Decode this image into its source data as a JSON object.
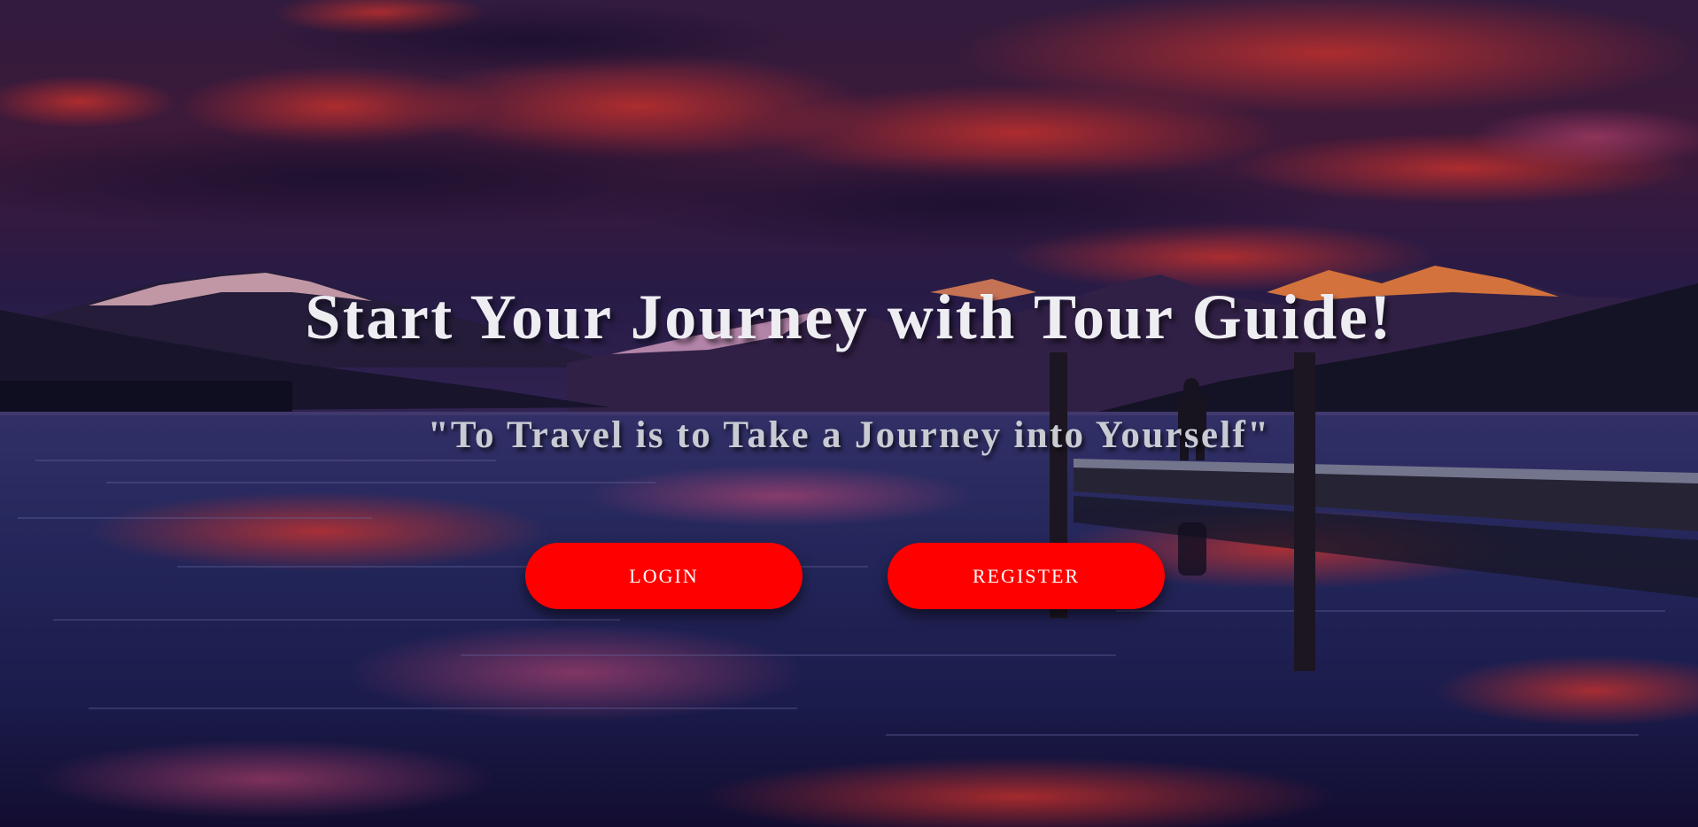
{
  "hero": {
    "title": "Start Your Journey with Tour Guide!",
    "quote": "\"To Travel is to Take a Journey into Yourself\""
  },
  "buttons": {
    "login_label": "LOGIN",
    "register_label": "REGISTER"
  },
  "colors": {
    "button_background": "#ff0000",
    "button_text": "#ffffff",
    "title_text": "#ededf2",
    "quote_text": "#c9cbd3"
  }
}
